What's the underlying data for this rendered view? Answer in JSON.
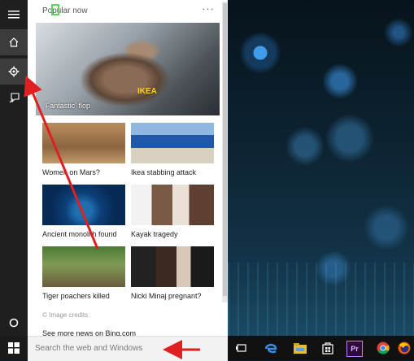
{
  "rail": {
    "items": [
      {
        "icon": "hamburger-icon"
      },
      {
        "icon": "home-icon"
      },
      {
        "icon": "notebook-settings-icon"
      },
      {
        "icon": "feedback-icon"
      }
    ],
    "bottom_icon": "cortana-ring-icon"
  },
  "panel": {
    "header": "Popular now",
    "more": "···",
    "hero": {
      "caption": "'Fantastic' flop"
    },
    "tiles": [
      {
        "caption": "Women on Mars?"
      },
      {
        "caption": "Ikea stabbing attack"
      },
      {
        "caption": "Ancient monolith found"
      },
      {
        "caption": "Kayak tragedy"
      },
      {
        "caption": "Tiger poachers killed"
      },
      {
        "caption": "Nicki Minaj pregnant?"
      }
    ],
    "credits": "© Image credits",
    "more_news": "See more news on Bing.com"
  },
  "search": {
    "placeholder": "Search the web and Windows"
  },
  "taskbar": {
    "icons": [
      "task-view-icon",
      "edge-icon",
      "file-explorer-icon",
      "store-icon",
      "premiere-icon",
      "chrome-icon",
      "firefox-icon"
    ],
    "premiere_label": "Pr"
  },
  "colors": {
    "annotation": "#e02020",
    "rail": "#1f1f1f",
    "taskbar": "#111111"
  }
}
